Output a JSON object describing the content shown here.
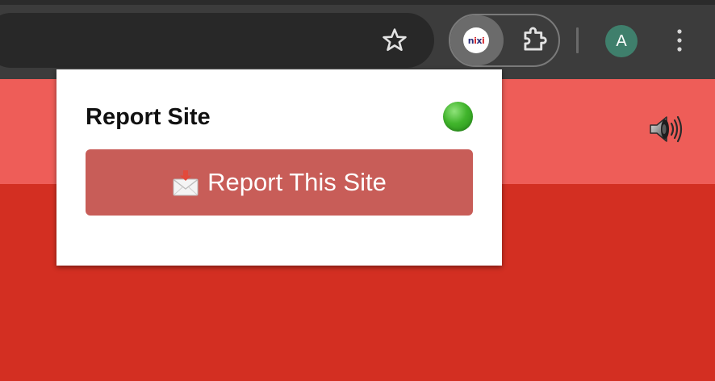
{
  "browser": {
    "extension_logo_text": {
      "n": "n",
      "i": "i",
      "x": "x",
      "i2": "i"
    },
    "profile_initial": "A",
    "icons": {
      "bookmark": "star-icon",
      "extension_active": "nixi-logo",
      "extensions": "puzzle-icon",
      "menu": "kebab-menu-icon"
    }
  },
  "page": {
    "icons": {
      "audio": "speaker-icon"
    },
    "colors": {
      "band": "#ee5d58",
      "background": "#d32f22"
    }
  },
  "popup": {
    "title": "Report Site",
    "status": "online",
    "status_color": "#41b52c",
    "report_button_label": "Report This Site",
    "report_button_icon": "envelope-incoming-icon",
    "report_button_color": "#c85d58"
  }
}
